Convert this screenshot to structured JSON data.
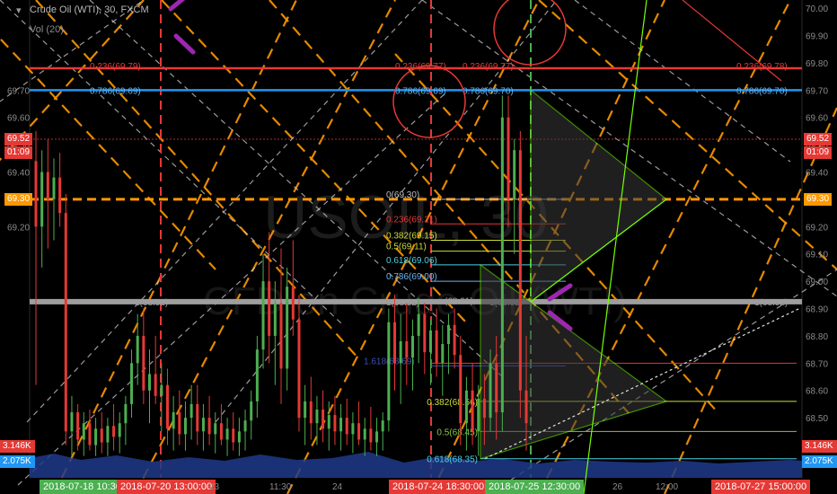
{
  "chart_header": {
    "instrument": "Crude Oil (WTI), 30, FXCM",
    "volume_label": "Vol (20)"
  },
  "watermark": {
    "line1": "USOIL, 30",
    "line2": "CFD on Crude Oil (WTI)"
  },
  "colors": {
    "background": "#000000",
    "candle_up": "#4caf50",
    "candle_down": "#e53935",
    "orange_dash": "#ff9800",
    "fib_blue": "#2196f3",
    "fib_red": "#e53935",
    "circle": "#e53935",
    "pointer": "#9c27b0",
    "grey_level": "#9e9e9e",
    "volume": "#1e3a8a"
  },
  "chart_data": {
    "type": "candlestick",
    "symbol": "USOIL",
    "interval": "30",
    "source": "FXCM",
    "ylim": [
      68.28,
      70.03
    ],
    "y_ticks": [
      "70.00",
      "69.90",
      "69.80",
      "69.70",
      "69.60",
      "69.50",
      "69.40",
      "69.30",
      "69.20",
      "69.10",
      "69.00",
      "68.90",
      "68.80",
      "68.70",
      "68.60",
      "68.50"
    ],
    "x_axis_labels": [
      "2018-07-18 10:30:00",
      "2018-07-20 13:00:00",
      "23",
      "11:30",
      "24",
      "2018-07-24 18:30:00",
      "2018-07-25 12:30:00",
      "26",
      "12:00",
      "2018-07-27 15:00:00"
    ],
    "price_tags": [
      {
        "side": "left",
        "text": "69.52",
        "value": 69.52,
        "bg": "#e53935"
      },
      {
        "side": "left",
        "text": "01:09",
        "value": 69.47,
        "bg": "#e53935"
      },
      {
        "side": "left",
        "text": "69.30",
        "value": 69.3,
        "bg": "#ff9800"
      },
      {
        "side": "right",
        "text": "69.52",
        "value": 69.52,
        "bg": "#e53935"
      },
      {
        "side": "right",
        "text": "01:09",
        "value": 69.47,
        "bg": "#e53935"
      },
      {
        "side": "right",
        "text": "69.30",
        "value": 69.3,
        "bg": "#ff9800"
      }
    ],
    "volume_tags": [
      {
        "text": "3.146K",
        "bg": "#e53935"
      },
      {
        "text": "2.075K",
        "bg": "#2196f3"
      }
    ],
    "horizontal_levels": [
      {
        "name": "orange-level",
        "value": 69.3,
        "color": "#ff9800",
        "style": "dashed"
      },
      {
        "name": "grey-level",
        "value": 68.925,
        "color": "#9e9e9e",
        "style": "solid"
      },
      {
        "name": "fib-0.236-top",
        "value": 69.78,
        "color": "#e53935",
        "style": "solid"
      },
      {
        "name": "fib-0.786-top",
        "value": 69.7,
        "color": "#2196f3",
        "style": "solid"
      }
    ],
    "fib_labels_upper": [
      "0.236(69.79)",
      "0.786(69.69)",
      "0.236(69.77)",
      "0.786(69.69)",
      "0.236(69.77)",
      "0.786(69.70)",
      "0.236(69.78)",
      "0.786(69.70)"
    ],
    "fib_retracement_mid": [
      {
        "label": "0(69.30)",
        "value": 69.3
      },
      {
        "label": "0.236(69.21)",
        "value": 69.21
      },
      {
        "label": "0.382(69.15)",
        "value": 69.15
      },
      {
        "label": "0.5(69.11)",
        "value": 69.11
      },
      {
        "label": "0.618(69.06)",
        "value": 69.06
      },
      {
        "label": "0.786(69.00)",
        "value": 69.0
      },
      {
        "label": "1.618(68.69)",
        "value": 68.69
      }
    ],
    "fib_retracement_low": [
      {
        "label": "0.382(68.56)",
        "value": 68.56
      },
      {
        "label": "0.5(68.45)",
        "value": 68.45
      },
      {
        "label": "0.618(68.35)",
        "value": 68.35
      }
    ],
    "grey_level_labels": [
      "1(68.92)",
      "1(68.92)",
      "1(68.92)",
      "1(68.92)"
    ],
    "extra_label": "(68.91)",
    "candles": [
      {
        "o": 69.44,
        "h": 69.55,
        "l": 68.62,
        "c": 69.2
      },
      {
        "o": 69.2,
        "h": 69.48,
        "l": 69.05,
        "c": 69.4
      },
      {
        "o": 69.4,
        "h": 69.52,
        "l": 69.12,
        "c": 69.3
      },
      {
        "o": 69.3,
        "h": 69.45,
        "l": 69.15,
        "c": 69.38
      },
      {
        "o": 69.38,
        "h": 69.47,
        "l": 69.2,
        "c": 69.25
      },
      {
        "o": 69.25,
        "h": 69.32,
        "l": 68.4,
        "c": 68.45
      },
      {
        "o": 68.45,
        "h": 68.58,
        "l": 68.36,
        "c": 68.52
      },
      {
        "o": 68.52,
        "h": 68.55,
        "l": 68.38,
        "c": 68.42
      },
      {
        "o": 68.42,
        "h": 68.52,
        "l": 68.36,
        "c": 68.48
      },
      {
        "o": 68.48,
        "h": 68.53,
        "l": 68.38,
        "c": 68.4
      },
      {
        "o": 68.4,
        "h": 68.5,
        "l": 68.36,
        "c": 68.46
      },
      {
        "o": 68.46,
        "h": 68.52,
        "l": 68.37,
        "c": 68.41
      },
      {
        "o": 68.41,
        "h": 68.5,
        "l": 68.36,
        "c": 68.47
      },
      {
        "o": 68.47,
        "h": 68.55,
        "l": 68.38,
        "c": 68.43
      },
      {
        "o": 68.43,
        "h": 68.52,
        "l": 68.37,
        "c": 68.48
      },
      {
        "o": 68.48,
        "h": 68.58,
        "l": 68.4,
        "c": 68.55
      },
      {
        "o": 68.55,
        "h": 68.75,
        "l": 68.5,
        "c": 68.7
      },
      {
        "o": 68.7,
        "h": 68.88,
        "l": 68.62,
        "c": 68.8
      },
      {
        "o": 68.8,
        "h": 68.9,
        "l": 68.55,
        "c": 68.6
      },
      {
        "o": 68.6,
        "h": 68.75,
        "l": 68.48,
        "c": 68.66
      },
      {
        "o": 68.66,
        "h": 68.8,
        "l": 68.55,
        "c": 68.58
      },
      {
        "o": 68.58,
        "h": 68.7,
        "l": 68.45,
        "c": 68.62
      },
      {
        "o": 68.62,
        "h": 68.68,
        "l": 68.4,
        "c": 68.46
      },
      {
        "o": 68.46,
        "h": 68.58,
        "l": 68.38,
        "c": 68.52
      },
      {
        "o": 68.52,
        "h": 68.6,
        "l": 68.4,
        "c": 68.44
      },
      {
        "o": 68.44,
        "h": 68.56,
        "l": 68.38,
        "c": 68.5
      },
      {
        "o": 68.5,
        "h": 68.62,
        "l": 68.42,
        "c": 68.55
      },
      {
        "o": 68.55,
        "h": 68.62,
        "l": 68.4,
        "c": 68.45
      },
      {
        "o": 68.45,
        "h": 68.55,
        "l": 68.38,
        "c": 68.5
      },
      {
        "o": 68.5,
        "h": 68.58,
        "l": 68.4,
        "c": 68.44
      },
      {
        "o": 68.44,
        "h": 68.52,
        "l": 68.37,
        "c": 68.48
      },
      {
        "o": 68.48,
        "h": 68.55,
        "l": 68.4,
        "c": 68.42
      },
      {
        "o": 68.42,
        "h": 68.5,
        "l": 68.36,
        "c": 68.46
      },
      {
        "o": 68.46,
        "h": 68.52,
        "l": 68.38,
        "c": 68.41
      },
      {
        "o": 68.41,
        "h": 68.5,
        "l": 68.36,
        "c": 68.45
      },
      {
        "o": 68.45,
        "h": 68.53,
        "l": 68.38,
        "c": 68.49
      },
      {
        "o": 68.49,
        "h": 68.6,
        "l": 68.42,
        "c": 68.56
      },
      {
        "o": 68.56,
        "h": 68.8,
        "l": 68.5,
        "c": 68.75
      },
      {
        "o": 68.75,
        "h": 69.1,
        "l": 68.68,
        "c": 69.0
      },
      {
        "o": 69.0,
        "h": 69.18,
        "l": 68.7,
        "c": 68.8
      },
      {
        "o": 68.8,
        "h": 69.0,
        "l": 68.62,
        "c": 68.92
      },
      {
        "o": 68.92,
        "h": 69.12,
        "l": 68.55,
        "c": 68.68
      },
      {
        "o": 68.68,
        "h": 69.05,
        "l": 68.6,
        "c": 68.98
      },
      {
        "o": 68.98,
        "h": 69.15,
        "l": 68.8,
        "c": 68.86
      },
      {
        "o": 68.86,
        "h": 68.95,
        "l": 68.45,
        "c": 68.5
      },
      {
        "o": 68.5,
        "h": 68.62,
        "l": 68.4,
        "c": 68.56
      },
      {
        "o": 68.56,
        "h": 68.65,
        "l": 68.42,
        "c": 68.48
      },
      {
        "o": 68.48,
        "h": 68.58,
        "l": 68.4,
        "c": 68.53
      },
      {
        "o": 68.53,
        "h": 68.6,
        "l": 68.41,
        "c": 68.46
      },
      {
        "o": 68.46,
        "h": 68.56,
        "l": 68.38,
        "c": 68.51
      },
      {
        "o": 68.51,
        "h": 68.58,
        "l": 68.4,
        "c": 68.45
      },
      {
        "o": 68.45,
        "h": 68.55,
        "l": 68.38,
        "c": 68.5
      },
      {
        "o": 68.5,
        "h": 68.57,
        "l": 68.4,
        "c": 68.44
      },
      {
        "o": 68.44,
        "h": 68.52,
        "l": 68.37,
        "c": 68.48
      },
      {
        "o": 68.48,
        "h": 68.56,
        "l": 68.4,
        "c": 68.42
      },
      {
        "o": 68.42,
        "h": 68.5,
        "l": 68.36,
        "c": 68.46
      },
      {
        "o": 68.46,
        "h": 68.54,
        "l": 68.38,
        "c": 68.41
      },
      {
        "o": 68.41,
        "h": 68.5,
        "l": 68.36,
        "c": 68.45
      },
      {
        "o": 68.45,
        "h": 68.52,
        "l": 68.38,
        "c": 68.49
      },
      {
        "o": 68.49,
        "h": 68.9,
        "l": 68.45,
        "c": 68.85
      },
      {
        "o": 68.85,
        "h": 68.95,
        "l": 68.6,
        "c": 68.7
      },
      {
        "o": 68.7,
        "h": 68.88,
        "l": 68.55,
        "c": 68.78
      },
      {
        "o": 68.78,
        "h": 68.92,
        "l": 68.62,
        "c": 68.72
      },
      {
        "o": 68.72,
        "h": 68.86,
        "l": 68.6,
        "c": 68.8
      },
      {
        "o": 68.8,
        "h": 68.94,
        "l": 68.7,
        "c": 68.88
      },
      {
        "o": 68.88,
        "h": 68.92,
        "l": 68.66,
        "c": 68.74
      },
      {
        "o": 68.74,
        "h": 68.86,
        "l": 68.62,
        "c": 68.82
      },
      {
        "o": 68.82,
        "h": 68.9,
        "l": 68.65,
        "c": 68.7
      },
      {
        "o": 68.7,
        "h": 68.84,
        "l": 68.58,
        "c": 68.77
      },
      {
        "o": 68.77,
        "h": 68.88,
        "l": 68.66,
        "c": 68.84
      },
      {
        "o": 68.84,
        "h": 68.9,
        "l": 68.68,
        "c": 68.73
      },
      {
        "o": 68.73,
        "h": 68.8,
        "l": 68.4,
        "c": 68.48
      },
      {
        "o": 68.48,
        "h": 68.65,
        "l": 68.38,
        "c": 68.6
      },
      {
        "o": 68.6,
        "h": 68.7,
        "l": 68.4,
        "c": 68.45
      },
      {
        "o": 68.45,
        "h": 68.62,
        "l": 68.36,
        "c": 68.57
      },
      {
        "o": 68.57,
        "h": 68.66,
        "l": 68.4,
        "c": 68.5
      },
      {
        "o": 68.5,
        "h": 68.75,
        "l": 68.45,
        "c": 68.7
      },
      {
        "o": 68.7,
        "h": 68.8,
        "l": 68.42,
        "c": 68.52
      },
      {
        "o": 68.52,
        "h": 69.68,
        "l": 68.45,
        "c": 69.6
      },
      {
        "o": 69.6,
        "h": 69.68,
        "l": 69.2,
        "c": 69.3
      },
      {
        "o": 69.3,
        "h": 69.52,
        "l": 69.1,
        "c": 69.48
      },
      {
        "o": 69.48,
        "h": 69.55,
        "l": 68.5,
        "c": 68.6
      },
      {
        "o": 68.6,
        "h": 68.8,
        "l": 68.38,
        "c": 68.48
      }
    ]
  }
}
